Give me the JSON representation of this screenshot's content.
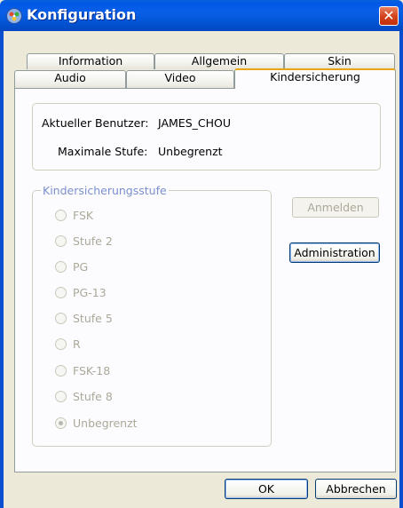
{
  "window": {
    "title": "Konfiguration"
  },
  "tabs_row1": [
    {
      "label": "Information"
    },
    {
      "label": "Allgemein"
    },
    {
      "label": "Skin"
    }
  ],
  "tabs_row2": [
    {
      "label": "Audio"
    },
    {
      "label": "Video"
    },
    {
      "label": "Kindersicherung",
      "active": true
    }
  ],
  "user_info": {
    "current_user_label": "Aktueller Benutzer:",
    "current_user_value": "JAMES_CHOU",
    "max_level_label": "Maximale Stufe:",
    "max_level_value": "Unbegrenzt"
  },
  "parental_level": {
    "title": "Kindersicherungsstufe",
    "options": [
      {
        "label": "FSK",
        "selected": false
      },
      {
        "label": "Stufe 2",
        "selected": false
      },
      {
        "label": "PG",
        "selected": false
      },
      {
        "label": "PG-13",
        "selected": false
      },
      {
        "label": "Stufe 5",
        "selected": false
      },
      {
        "label": "R",
        "selected": false
      },
      {
        "label": "FSK-18",
        "selected": false
      },
      {
        "label": "Stufe 8",
        "selected": false
      },
      {
        "label": "Unbegrenzt",
        "selected": true
      }
    ]
  },
  "buttons": {
    "login": "Anmelden",
    "administration": "Administration",
    "ok": "OK",
    "cancel": "Abbrechen"
  },
  "colors": {
    "titlebar": "#0058E6",
    "dialog_bg": "#ECE9D8",
    "active_tab_accent": "#E8A614",
    "group_title": "#7B8FCF",
    "disabled_text": "#ACA899"
  }
}
